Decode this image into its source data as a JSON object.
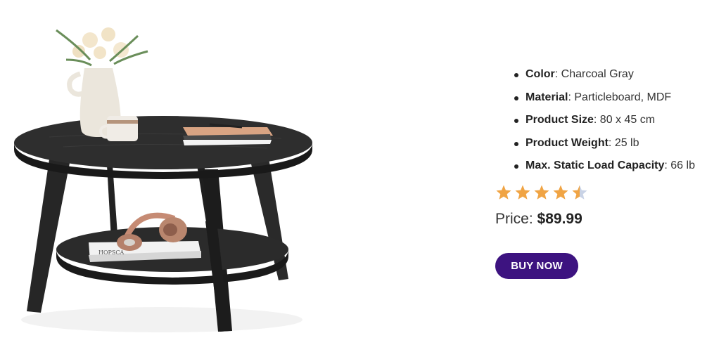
{
  "product": {
    "image_alt": "Round coffee table with lower shelf",
    "image_props": {
      "book_top_text": "HOPSCA"
    }
  },
  "specs": [
    {
      "key": "Color",
      "value": "Charcoal Gray"
    },
    {
      "key": "Material",
      "value": "Particleboard, MDF"
    },
    {
      "key": "Product Size",
      "value": "80 x 45 cm"
    },
    {
      "key": "Product Weight",
      "value": "25 lb"
    },
    {
      "key": "Max. Static Load Capacity",
      "value": "66 lb"
    }
  ],
  "rating": {
    "value": 4.5,
    "max": 5,
    "filled_color": "#f0a444",
    "empty_color": "#c9d3e6"
  },
  "price": {
    "label": "Price:",
    "value": "$89.99"
  },
  "buy_button": {
    "label": "BUY NOW",
    "color": "#3d1380"
  }
}
